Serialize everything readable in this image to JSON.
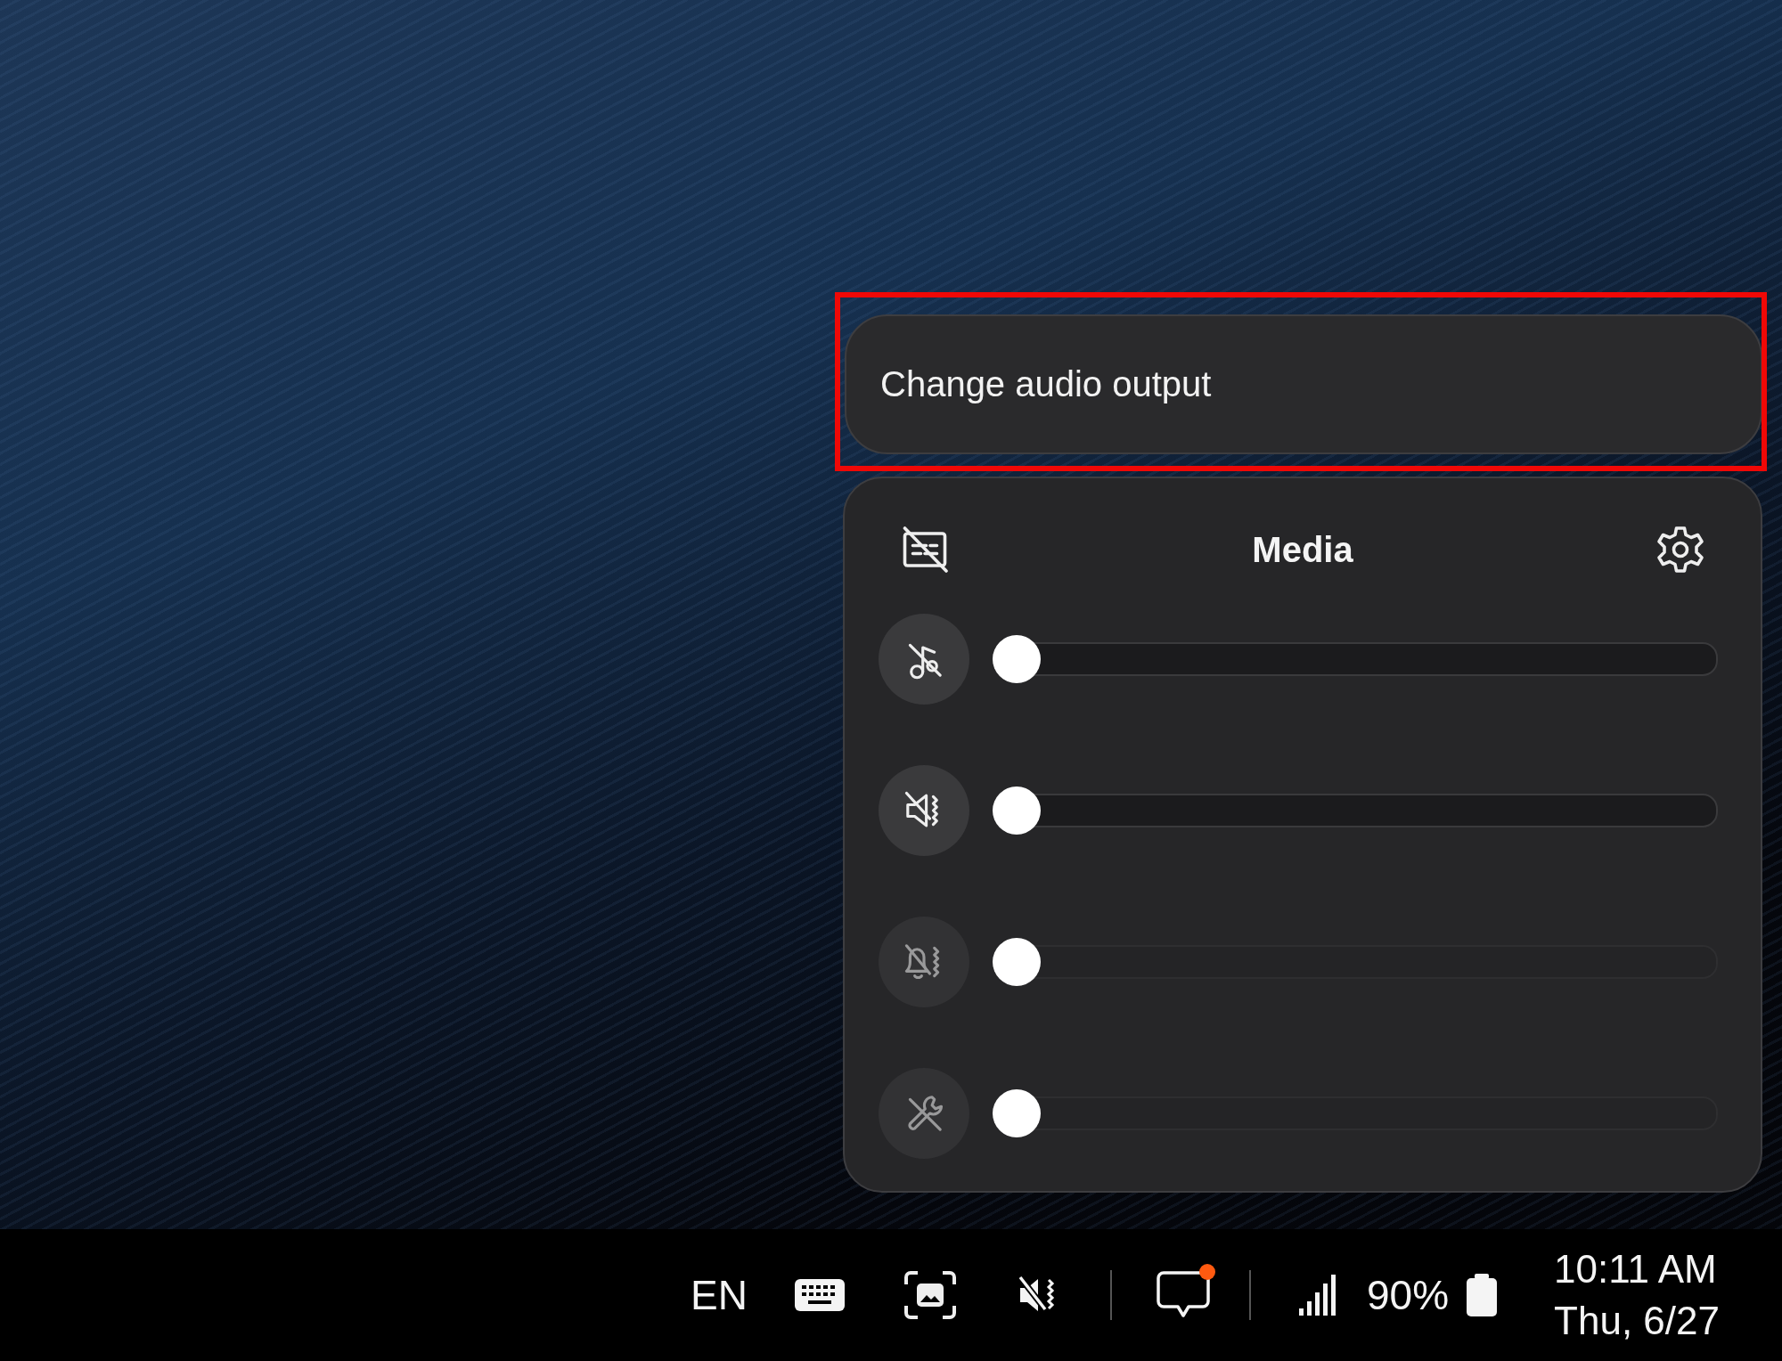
{
  "output_button": {
    "label": "Change audio output",
    "highlighted": true
  },
  "media_panel": {
    "title": "Media",
    "sliders": [
      {
        "kind": "media",
        "level": 0,
        "disabled": false
      },
      {
        "kind": "ringtone",
        "level": 0,
        "disabled": false
      },
      {
        "kind": "notification",
        "level": 0,
        "disabled": true
      },
      {
        "kind": "system",
        "level": 0,
        "disabled": true
      }
    ]
  },
  "taskbar": {
    "language": "EN",
    "notification_dot": true,
    "battery": "90%",
    "time": "10:11 AM",
    "date": "Thu, 6/27"
  }
}
